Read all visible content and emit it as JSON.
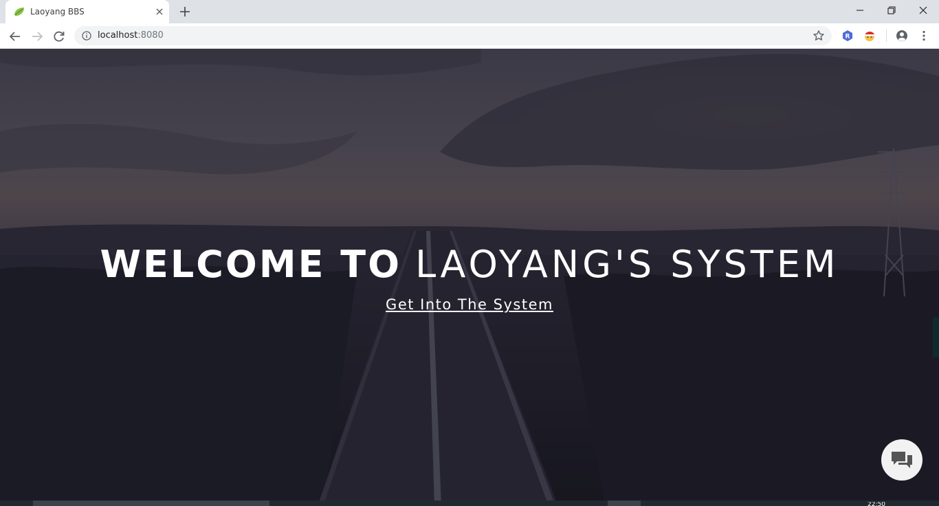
{
  "browser": {
    "tab_title": "Laoyang BBS",
    "url_host": "localhost",
    "url_port": ":8080"
  },
  "hero": {
    "title_bold": "WELCOME TO",
    "title_light": "LAOYANG'S SYSTEM",
    "link_label": "Get Into The System"
  },
  "taskbar": {
    "clock": "22:50"
  },
  "icons": {
    "favicon": "leaf-icon",
    "chat": "chat-bubbles-icon"
  },
  "colors": {
    "overlay": "#1b1a26",
    "chrome_tabstrip": "#dee1e6",
    "omnibox": "#f1f3f4"
  }
}
